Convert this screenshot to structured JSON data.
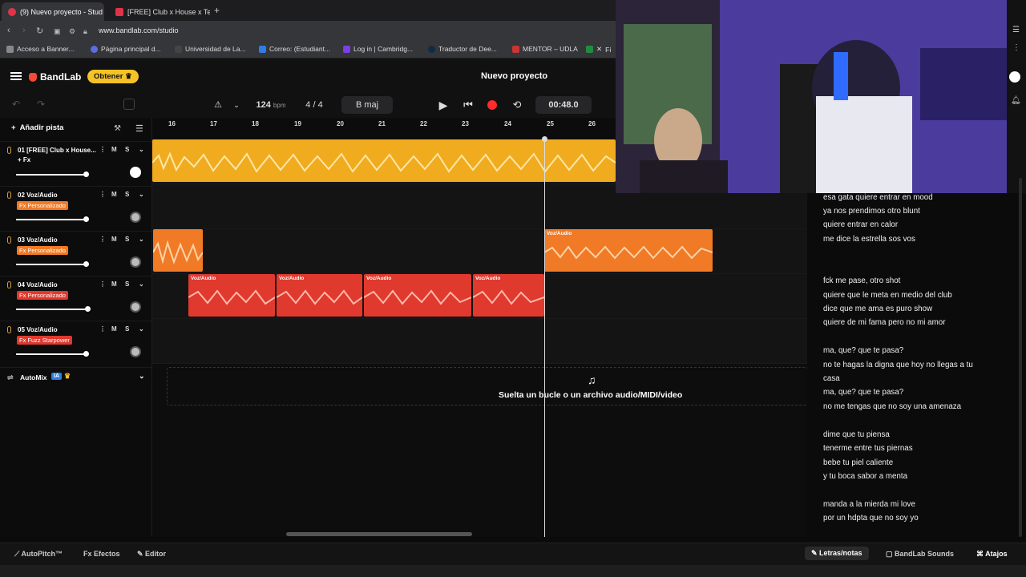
{
  "browser": {
    "tabs": [
      {
        "title": "(9) Nuevo proyecto - Stud"
      },
      {
        "title": "[FREE] Club x House x Tec"
      }
    ],
    "url": "www.bandlab.com/studio",
    "bookmarks": [
      "Acceso a Banner...",
      "Página principal d...",
      "Universidad de La...",
      "Correo: (Estudiant...",
      "Log in | Cambridg...",
      "Traductor de Dee...",
      "MENTOR – UDLA",
      "Fi"
    ]
  },
  "app": {
    "logo": "BandLab",
    "obtener": "Obtener",
    "project_title": "Nuevo proyecto"
  },
  "transport": {
    "bpm_value": "124",
    "bpm_unit": "bpm",
    "time_sig": "4 / 4",
    "key": "B maj",
    "time": "00:48.0"
  },
  "tracklist": {
    "add_track": "Añadir pista",
    "tracks": [
      {
        "name": "01  [FREE] Club x House...",
        "fx": "+ Fx",
        "m": "M",
        "s": "S"
      },
      {
        "name": "02  Voz/Audio",
        "fx": "Fx Personalizado",
        "m": "M",
        "s": "S"
      },
      {
        "name": "03  Voz/Audio",
        "fx": "Fx Personalizado",
        "m": "M",
        "s": "S"
      },
      {
        "name": "04  Voz/Audio",
        "fx": "Fx Personalizado",
        "m": "M",
        "s": "S"
      },
      {
        "name": "05  Voz/Audio",
        "fx": "Fx Fuzz Starpower",
        "m": "M",
        "s": "S"
      }
    ],
    "automix": "AutoMix",
    "ia": "IA"
  },
  "ruler": [
    "16",
    "17",
    "18",
    "19",
    "20",
    "21",
    "22",
    "23",
    "24",
    "25",
    "26"
  ],
  "clips": {
    "label": "Voz/Audio"
  },
  "dropzone": "Suelta un bucle o un archivo audio/MIDI/video",
  "lyrics": [
    "esa gata quiere entrar en mood",
    "ya nos prendimos otro blunt",
    "quiere entrar en calor",
    "me dice la estrella sos vos",
    "fck me pase, otro shot",
    "quiere que le meta en medio del club",
    "dice que me ama es puro show",
    "quiere de mi fama pero no mi amor",
    "ma, que? que te pasa?",
    "no te hagas la digna que hoy no llegas a tu",
    "casa",
    "ma, que? que te pasa?",
    "no me tengas que no soy una amenaza",
    "dime que tu piensa",
    "tenerme entre tus piernas",
    "bebe tu piel caliente",
    "y tu boca sabor a menta",
    "manda a la mierda mi love",
    "por un hdpta que no soy yo"
  ],
  "footer": {
    "autopitch": "AutoPitch™",
    "efectos": "Efectos",
    "editor": "Editor",
    "letras": "Letras/notas",
    "sounds": "BandLab Sounds",
    "atajos": "Atajos"
  },
  "colors": {
    "track1": "#f1ab1f",
    "track3": "#f07a25",
    "track4": "#e0392e",
    "record": "#ff2a2a"
  }
}
